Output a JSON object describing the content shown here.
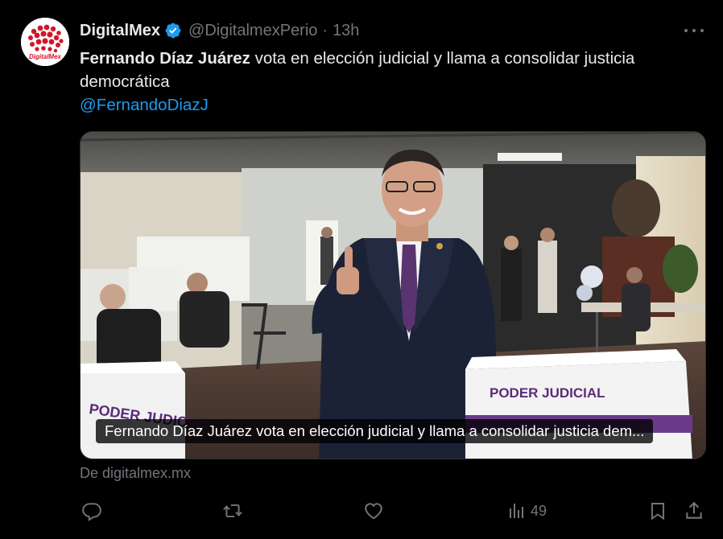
{
  "author": {
    "display_name": "DigitalMex",
    "handle": "@DigitalmexPerio",
    "separator": "·",
    "time": "13h",
    "avatar_text": "DigitalMex",
    "verified_icon": "verified-badge-icon",
    "accent_color": "#1d9bf0"
  },
  "tweet": {
    "text_bold": "Fernando Díaz Juárez",
    "text_rest": " vota en elección judicial y llama a consolidar justicia democrática",
    "mention": "@FernandoDiazJ"
  },
  "media": {
    "caption": "Fernando Díaz Juárez vota en elección judicial y llama a consolidar justicia dem...",
    "box_label": "PODER JUDICIAL"
  },
  "card": {
    "source": "De digitalmex.mx"
  },
  "actions": {
    "reply_icon": "reply-icon",
    "retweet_icon": "retweet-icon",
    "like_icon": "heart-icon",
    "views_icon": "views-icon",
    "views_count": "49",
    "bookmark_icon": "bookmark-icon",
    "share_icon": "share-icon"
  },
  "more_icon": "more-options-icon"
}
